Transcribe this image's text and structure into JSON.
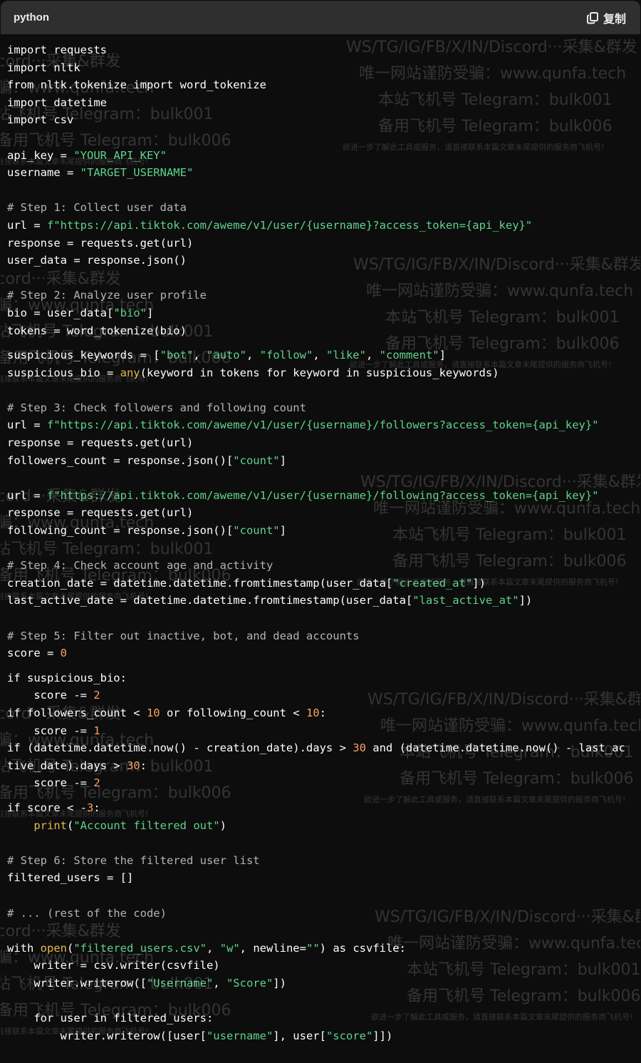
{
  "header": {
    "language": "python",
    "copy_label": "复制",
    "copy_icon": "copy-icon"
  },
  "code": {
    "lines": [
      {
        "segs": [
          {
            "t": "import requests",
            "c": "plain"
          }
        ]
      },
      {
        "segs": [
          {
            "t": "import nltk",
            "c": "plain"
          }
        ]
      },
      {
        "segs": [
          {
            "t": "from nltk.tokenize import word_tokenize",
            "c": "plain"
          }
        ]
      },
      {
        "segs": [
          {
            "t": "import datetime",
            "c": "plain"
          }
        ]
      },
      {
        "segs": [
          {
            "t": "import csv",
            "c": "plain"
          }
        ]
      },
      {
        "segs": [],
        "blank": true
      },
      {
        "segs": [
          {
            "t": "api_key = ",
            "c": "plain"
          },
          {
            "t": "\"YOUR_API_KEY\"",
            "c": "string"
          }
        ]
      },
      {
        "segs": [
          {
            "t": "username = ",
            "c": "plain"
          },
          {
            "t": "\"TARGET_USERNAME\"",
            "c": "string"
          }
        ]
      },
      {
        "segs": [],
        "blank": true
      },
      {
        "segs": [
          {
            "t": "# Step 1: Collect user data",
            "c": "comment"
          }
        ]
      },
      {
        "segs": [
          {
            "t": "url = ",
            "c": "plain"
          },
          {
            "t": "f\"https://api.tiktok.com/aweme/v1/user/{username}?access_token={api_key}\"",
            "c": "string"
          }
        ]
      },
      {
        "segs": [
          {
            "t": "response = requests.get(url)",
            "c": "plain"
          }
        ]
      },
      {
        "segs": [
          {
            "t": "user_data = response.json()",
            "c": "plain"
          }
        ]
      },
      {
        "segs": [],
        "blank": true
      },
      {
        "segs": [
          {
            "t": "# Step 2: Analyze user profile",
            "c": "comment"
          }
        ]
      },
      {
        "segs": [
          {
            "t": "bio = user_data[",
            "c": "plain"
          },
          {
            "t": "\"bio\"",
            "c": "string"
          },
          {
            "t": "]",
            "c": "plain"
          }
        ]
      },
      {
        "segs": [
          {
            "t": "tokens = word_tokenize(bio)",
            "c": "plain"
          }
        ]
      },
      {
        "segs": [
          {
            "t": "suspicious_keywords = [",
            "c": "plain"
          },
          {
            "t": "\"bot\"",
            "c": "string"
          },
          {
            "t": ", ",
            "c": "plain"
          },
          {
            "t": "\"auto\"",
            "c": "string"
          },
          {
            "t": ", ",
            "c": "plain"
          },
          {
            "t": "\"follow\"",
            "c": "string"
          },
          {
            "t": ", ",
            "c": "plain"
          },
          {
            "t": "\"like\"",
            "c": "string"
          },
          {
            "t": ", ",
            "c": "plain"
          },
          {
            "t": "\"comment\"",
            "c": "string"
          },
          {
            "t": "]",
            "c": "plain"
          }
        ],
        "gap": true
      },
      {
        "segs": [
          {
            "t": "suspicious_bio = ",
            "c": "plain"
          },
          {
            "t": "any",
            "c": "builtin"
          },
          {
            "t": "(keyword in tokens for keyword in suspicious_keywords)",
            "c": "plain"
          }
        ]
      },
      {
        "segs": [],
        "blank": true
      },
      {
        "segs": [
          {
            "t": "# Step 3: Check followers and following count",
            "c": "comment"
          }
        ]
      },
      {
        "segs": [
          {
            "t": "url = ",
            "c": "plain"
          },
          {
            "t": "f\"https://api.tiktok.com/aweme/v1/user/{username}/followers?access_token={api_key}\"",
            "c": "string"
          }
        ]
      },
      {
        "segs": [
          {
            "t": "response = requests.get(url)",
            "c": "plain"
          }
        ]
      },
      {
        "segs": [
          {
            "t": "followers_count = response.json()[",
            "c": "plain"
          },
          {
            "t": "\"count\"",
            "c": "string"
          },
          {
            "t": "]",
            "c": "plain"
          }
        ]
      },
      {
        "segs": [],
        "blank": true
      },
      {
        "segs": [
          {
            "t": "url = ",
            "c": "plain"
          },
          {
            "t": "f\"https://api.tiktok.com/aweme/v1/user/{username}/following?access_token={api_key}\"",
            "c": "string"
          }
        ]
      },
      {
        "segs": [
          {
            "t": "response = requests.get(url)",
            "c": "plain"
          }
        ]
      },
      {
        "segs": [
          {
            "t": "following_count = response.json()[",
            "c": "plain"
          },
          {
            "t": "\"count\"",
            "c": "string"
          },
          {
            "t": "]",
            "c": "plain"
          }
        ]
      },
      {
        "segs": [],
        "blank": true
      },
      {
        "segs": [
          {
            "t": "# Step 4: Check account age and activity",
            "c": "comment"
          }
        ]
      },
      {
        "segs": [
          {
            "t": "creation_date = datetime.datetime.fromtimestamp(user_data[",
            "c": "plain"
          },
          {
            "t": "\"created_at\"",
            "c": "string"
          },
          {
            "t": "])",
            "c": "plain"
          }
        ]
      },
      {
        "segs": [
          {
            "t": "last_active_date = datetime.datetime.fromtimestamp(user_data[",
            "c": "plain"
          },
          {
            "t": "\"last_active_at\"",
            "c": "string"
          },
          {
            "t": "])",
            "c": "plain"
          }
        ]
      },
      {
        "segs": [],
        "blank": true
      },
      {
        "segs": [
          {
            "t": "# Step 5: Filter out inactive, bot, and dead accounts",
            "c": "comment"
          }
        ]
      },
      {
        "segs": [
          {
            "t": "score = ",
            "c": "plain"
          },
          {
            "t": "0",
            "c": "number"
          }
        ]
      },
      {
        "segs": [
          {
            "t": "if suspicious_bio:",
            "c": "plain"
          }
        ],
        "gap": true
      },
      {
        "segs": [
          {
            "t": "    score -= ",
            "c": "plain"
          },
          {
            "t": "2",
            "c": "number"
          }
        ]
      },
      {
        "segs": [
          {
            "t": "if followers_count < ",
            "c": "plain"
          },
          {
            "t": "10",
            "c": "number"
          },
          {
            "t": " or following_count < ",
            "c": "plain"
          },
          {
            "t": "10",
            "c": "number"
          },
          {
            "t": ":",
            "c": "plain"
          }
        ]
      },
      {
        "segs": [
          {
            "t": "    score -= ",
            "c": "plain"
          },
          {
            "t": "1",
            "c": "number"
          }
        ]
      },
      {
        "segs": [
          {
            "t": "if (datetime.datetime.now() - creation_date).days > ",
            "c": "plain"
          },
          {
            "t": "30",
            "c": "number"
          },
          {
            "t": " and (datetime.datetime.now() - last_ac",
            "c": "plain"
          }
        ]
      },
      {
        "segs": [
          {
            "t": "tive_date).days > ",
            "c": "plain"
          },
          {
            "t": "30",
            "c": "number"
          },
          {
            "t": ":",
            "c": "plain"
          }
        ]
      },
      {
        "segs": [
          {
            "t": "    score -= ",
            "c": "plain"
          },
          {
            "t": "2",
            "c": "number"
          }
        ]
      },
      {
        "segs": [
          {
            "t": "if score < -",
            "c": "plain"
          },
          {
            "t": "3",
            "c": "number"
          },
          {
            "t": ":",
            "c": "plain"
          }
        ],
        "gap": true
      },
      {
        "segs": [
          {
            "t": "    ",
            "c": "plain"
          },
          {
            "t": "print",
            "c": "builtin"
          },
          {
            "t": "(",
            "c": "plain"
          },
          {
            "t": "\"Account filtered out\"",
            "c": "string"
          },
          {
            "t": ")",
            "c": "plain"
          }
        ]
      },
      {
        "segs": [],
        "blank": true
      },
      {
        "segs": [
          {
            "t": "# Step 6: Store the filtered user list",
            "c": "comment"
          }
        ]
      },
      {
        "segs": [
          {
            "t": "filtered_users = []",
            "c": "plain"
          }
        ]
      },
      {
        "segs": [],
        "blank": true
      },
      {
        "segs": [
          {
            "t": "# ... (rest of the code)",
            "c": "comment"
          }
        ]
      },
      {
        "segs": [],
        "blank": true
      },
      {
        "segs": [
          {
            "t": "with ",
            "c": "plain"
          },
          {
            "t": "open",
            "c": "builtin"
          },
          {
            "t": "(",
            "c": "plain"
          },
          {
            "t": "\"filtered_users.csv\"",
            "c": "string"
          },
          {
            "t": ", ",
            "c": "plain"
          },
          {
            "t": "\"w\"",
            "c": "string"
          },
          {
            "t": ", newline=",
            "c": "plain"
          },
          {
            "t": "\"\"",
            "c": "string"
          },
          {
            "t": ") as csvfile:",
            "c": "plain"
          }
        ]
      },
      {
        "segs": [
          {
            "t": "    writer = csv.writer(csvfile)",
            "c": "plain"
          }
        ]
      },
      {
        "segs": [
          {
            "t": "    writer.writerow([",
            "c": "plain"
          },
          {
            "t": "\"Username\"",
            "c": "string"
          },
          {
            "t": ", ",
            "c": "plain"
          },
          {
            "t": "\"Score\"",
            "c": "string"
          },
          {
            "t": "])",
            "c": "plain"
          }
        ]
      },
      {
        "segs": [],
        "blank": true
      },
      {
        "segs": [
          {
            "t": "    for user in filtered_users:",
            "c": "plain"
          }
        ]
      },
      {
        "segs": [
          {
            "t": "        writer.writerow([user[",
            "c": "plain"
          },
          {
            "t": "\"username\"",
            "c": "string"
          },
          {
            "t": "], user[",
            "c": "plain"
          },
          {
            "t": "\"score\"",
            "c": "string"
          },
          {
            "t": "]])",
            "c": "plain"
          }
        ]
      }
    ]
  },
  "watermark": {
    "line1": "WS/TG/IG/FB/X/IN/Discord···采集&群发",
    "line2": "唯一网站谨防受骗：www.qunfa.tech",
    "line3": "本站飞机号 Telegram：bulk001",
    "line4": "备用飞机号 Telegram：bulk006",
    "line5": "欲进一步了解此工具或服务，请直接联系本篇文章末尾提供的服务商飞机号!"
  },
  "colors": {
    "background": "#0d0d0d",
    "header": "#2f2f2f",
    "string": "#5fd38b",
    "number": "#ff9e64",
    "builtin": "#e5b94a",
    "comment": "#b4b4b4"
  }
}
